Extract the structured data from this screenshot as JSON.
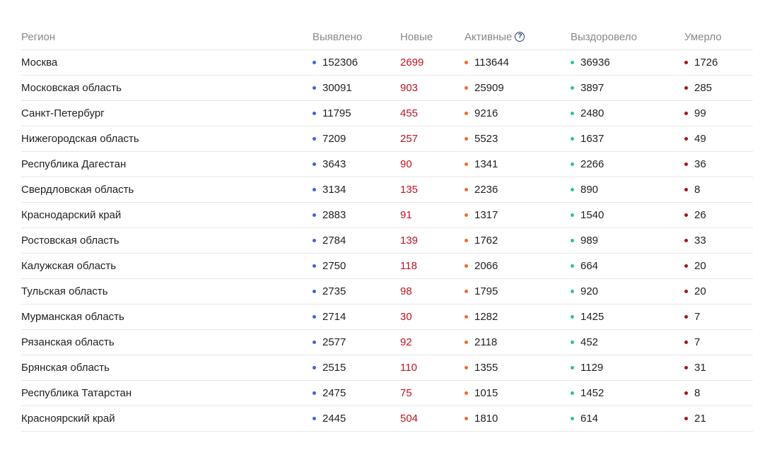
{
  "headers": {
    "region": "Регион",
    "detected": "Выявлено",
    "new": "Новые",
    "active": "Активные",
    "recovered": "Выздоровело",
    "died": "Умерло",
    "help_icon": "?"
  },
  "colors": {
    "detected_dot": "#3f64d8",
    "new_text": "#c1121f",
    "active_dot": "#f06b2b",
    "recovered_dot": "#31c48d",
    "died_dot": "#a6141a"
  },
  "rows": [
    {
      "region": "Москва",
      "detected": "152306",
      "new": "2699",
      "active": "113644",
      "recovered": "36936",
      "died": "1726"
    },
    {
      "region": "Московская область",
      "detected": "30091",
      "new": "903",
      "active": "25909",
      "recovered": "3897",
      "died": "285"
    },
    {
      "region": "Санкт-Петербург",
      "detected": "11795",
      "new": "455",
      "active": "9216",
      "recovered": "2480",
      "died": "99"
    },
    {
      "region": "Нижегородская область",
      "detected": "7209",
      "new": "257",
      "active": "5523",
      "recovered": "1637",
      "died": "49"
    },
    {
      "region": "Республика Дагестан",
      "detected": "3643",
      "new": "90",
      "active": "1341",
      "recovered": "2266",
      "died": "36"
    },
    {
      "region": "Свердловская область",
      "detected": "3134",
      "new": "135",
      "active": "2236",
      "recovered": "890",
      "died": "8"
    },
    {
      "region": "Краснодарский край",
      "detected": "2883",
      "new": "91",
      "active": "1317",
      "recovered": "1540",
      "died": "26"
    },
    {
      "region": "Ростовская область",
      "detected": "2784",
      "new": "139",
      "active": "1762",
      "recovered": "989",
      "died": "33"
    },
    {
      "region": "Калужская область",
      "detected": "2750",
      "new": "118",
      "active": "2066",
      "recovered": "664",
      "died": "20"
    },
    {
      "region": "Тульская область",
      "detected": "2735",
      "new": "98",
      "active": "1795",
      "recovered": "920",
      "died": "20"
    },
    {
      "region": "Мурманская область",
      "detected": "2714",
      "new": "30",
      "active": "1282",
      "recovered": "1425",
      "died": "7"
    },
    {
      "region": "Рязанская область",
      "detected": "2577",
      "new": "92",
      "active": "2118",
      "recovered": "452",
      "died": "7"
    },
    {
      "region": "Брянская область",
      "detected": "2515",
      "new": "110",
      "active": "1355",
      "recovered": "1129",
      "died": "31"
    },
    {
      "region": "Республика Татарстан",
      "detected": "2475",
      "new": "75",
      "active": "1015",
      "recovered": "1452",
      "died": "8"
    },
    {
      "region": "Красноярский край",
      "detected": "2445",
      "new": "504",
      "active": "1810",
      "recovered": "614",
      "died": "21"
    }
  ]
}
